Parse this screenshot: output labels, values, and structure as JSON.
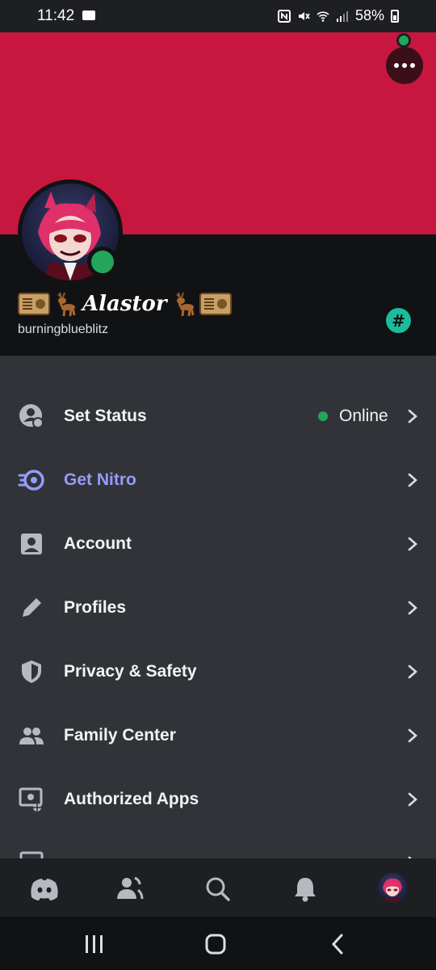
{
  "status_bar": {
    "time": "11:42",
    "battery": "58%"
  },
  "profile": {
    "display_name": "Alastor",
    "username": "burningblueblitz",
    "status_color": "#23a55a",
    "banner_color": "#c8173f"
  },
  "menu": {
    "items": [
      {
        "label": "Set Status",
        "icon": "status-icon",
        "value": "Online"
      },
      {
        "label": "Get Nitro",
        "icon": "nitro-icon"
      },
      {
        "label": "Account",
        "icon": "account-icon"
      },
      {
        "label": "Profiles",
        "icon": "pencil-icon"
      },
      {
        "label": "Privacy & Safety",
        "icon": "shield-icon"
      },
      {
        "label": "Family Center",
        "icon": "people-icon"
      },
      {
        "label": "Authorized Apps",
        "icon": "apps-icon"
      }
    ]
  },
  "bottom_nav": [
    "discord-home-icon",
    "friends-icon",
    "search-icon",
    "notifications-icon",
    "profile-avatar"
  ],
  "colors": {
    "accent_nitro": "#949cf7",
    "online": "#23a55a",
    "badge": "#1abc9c"
  }
}
